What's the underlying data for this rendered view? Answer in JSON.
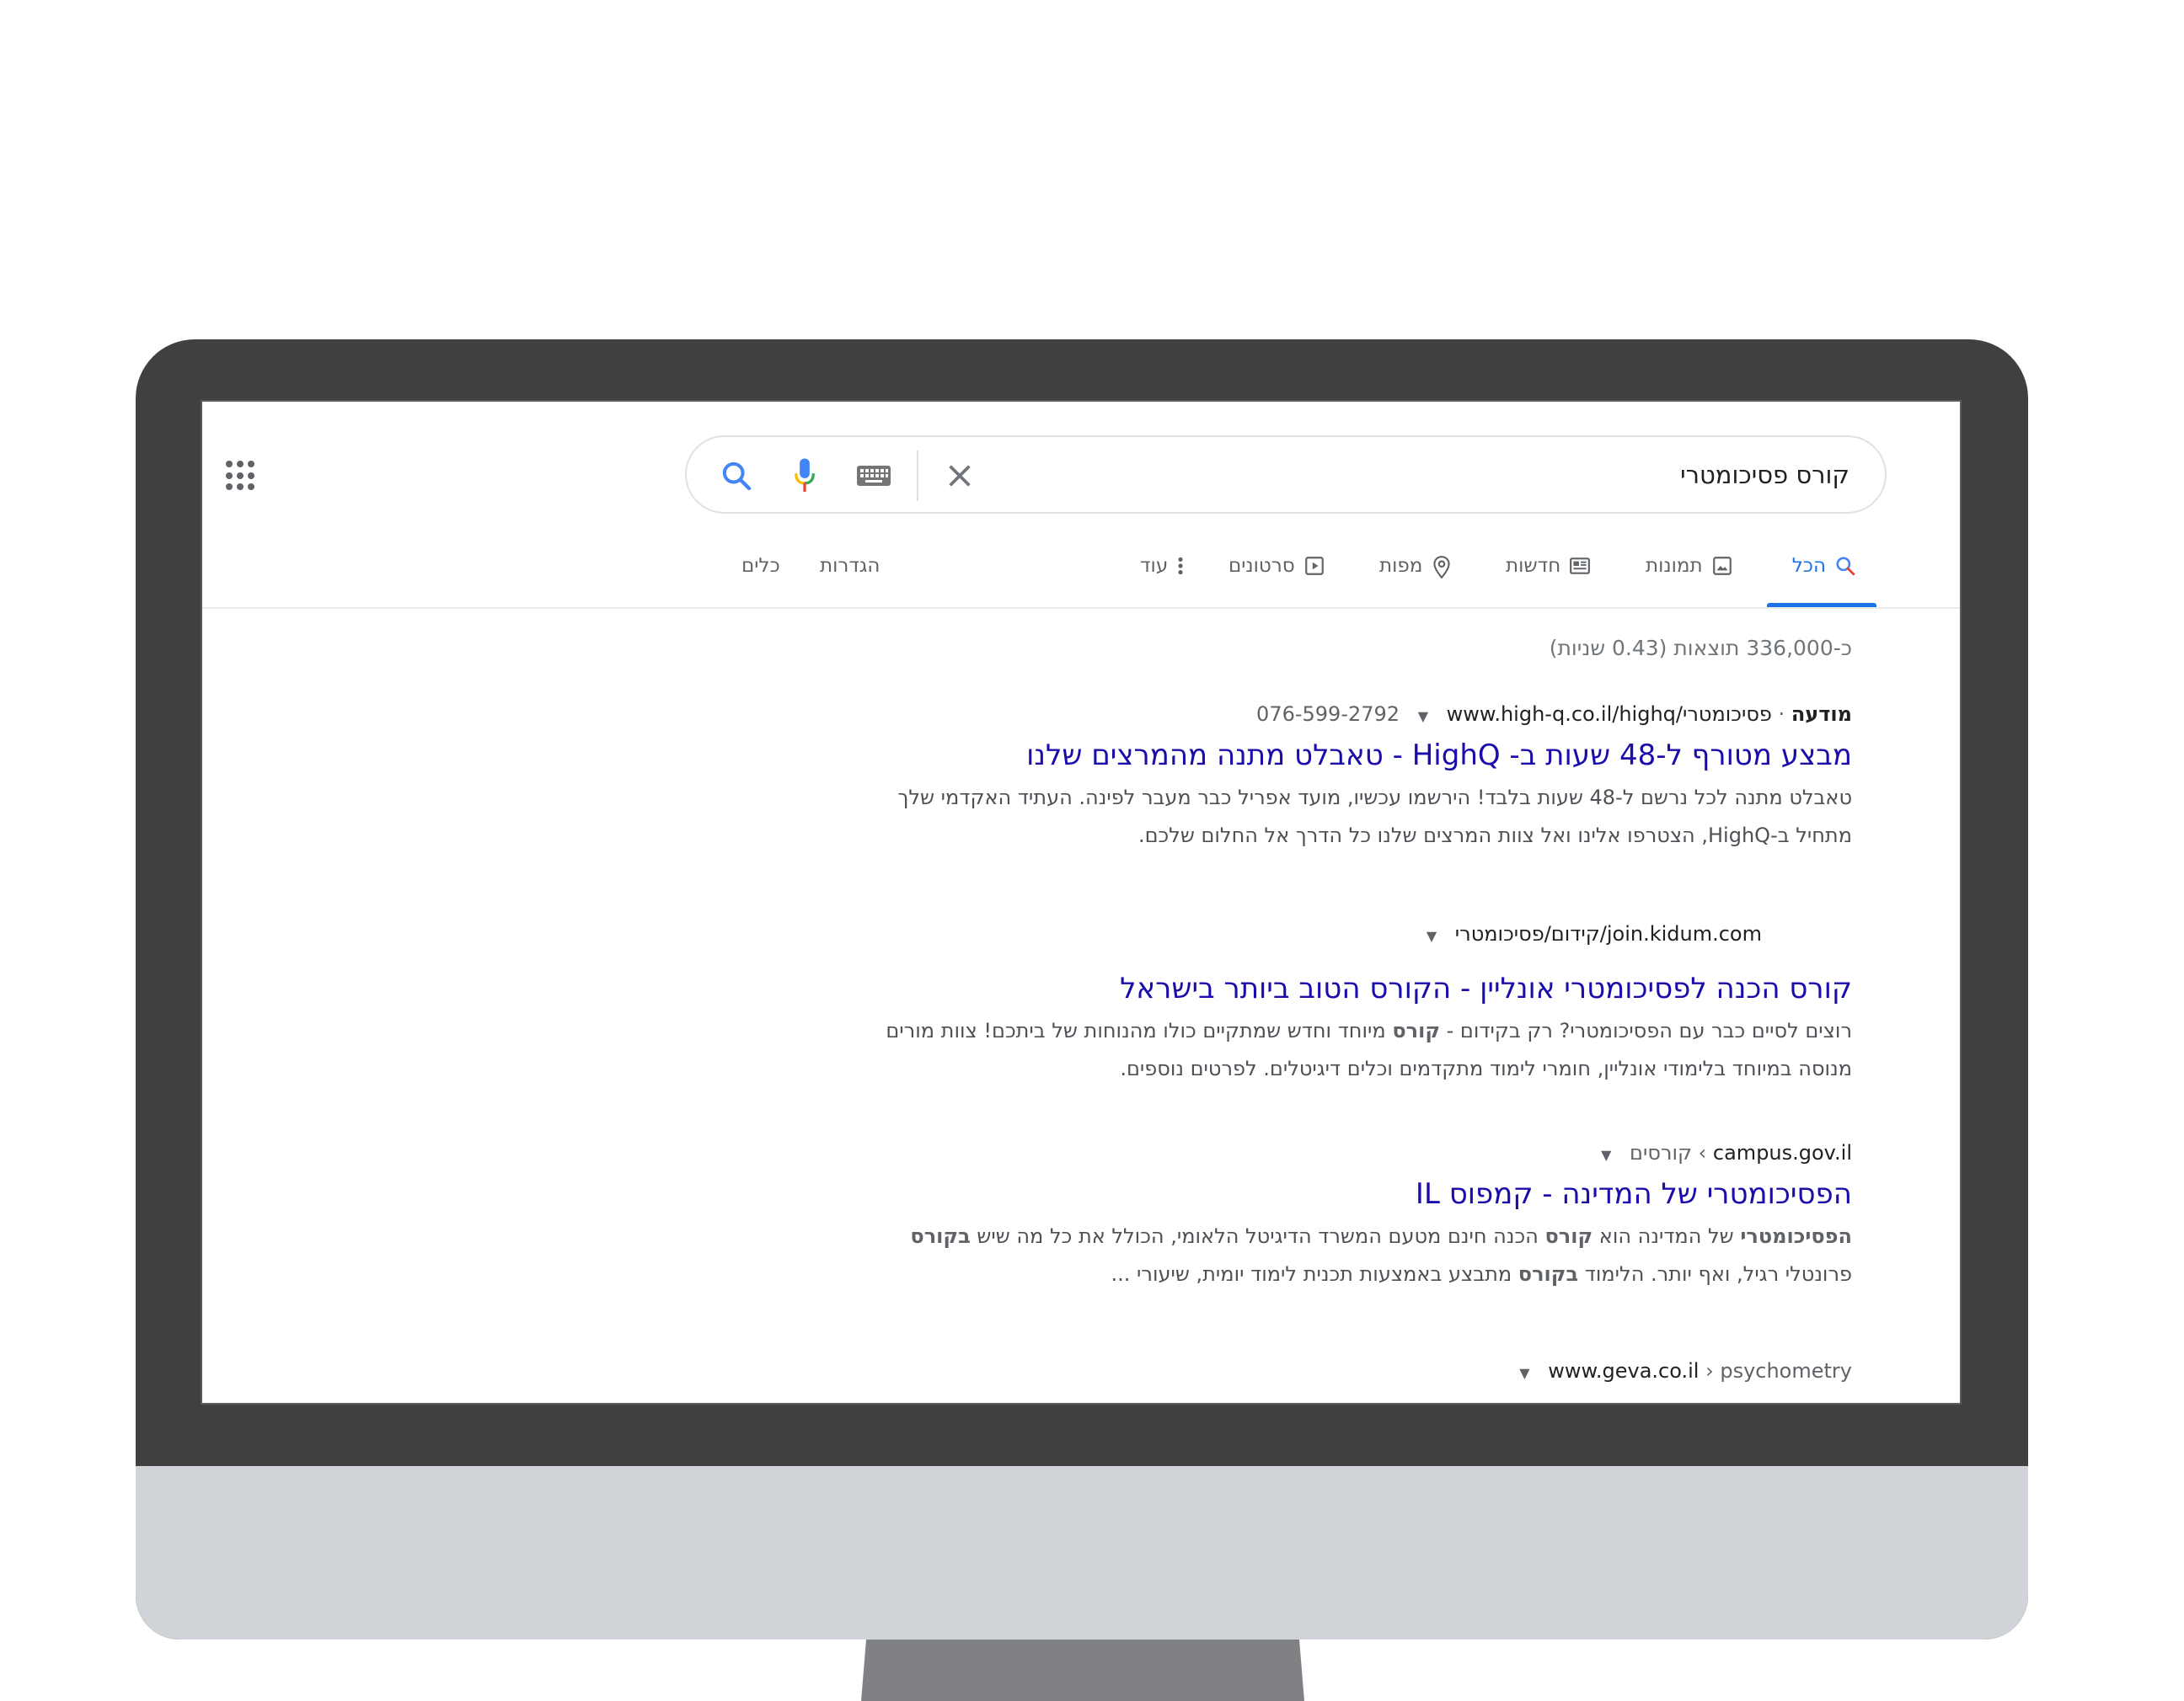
{
  "search": {
    "query": "קורס פסיכומטרי"
  },
  "tabs": [
    {
      "label": "הכל",
      "icon": "search-icon",
      "active": true
    },
    {
      "label": "תמונות",
      "icon": "image-icon"
    },
    {
      "label": "חדשות",
      "icon": "news-icon"
    },
    {
      "label": "מפות",
      "icon": "map-pin-icon"
    },
    {
      "label": "סרטונים",
      "icon": "video-icon"
    },
    {
      "label": "עוד",
      "icon": "more-vert-icon"
    }
  ],
  "tools": {
    "settings_label": "הגדרות",
    "tools_label": "כלים"
  },
  "result_stats": "כ-336,000 תוצאות (0.43 שניות)",
  "results": [
    {
      "ad_label": "מודעה",
      "url": "www.high-q.co.il/highq/פסיכומטרי",
      "phone": "076-599-2792",
      "title": "מבצע מטורף ל-48 שעות ב- HighQ - טאבלט מתנה מהמרצים שלנו",
      "snippet_line1": "טאבלט מתנה לכל נרשם ל-48 שעות בלבד! הירשמו עכשיו, מועד אפריל כבר מעבר לפינה. העתיד האקדמי שלך",
      "snippet_line2": "מתחיל ב-HighQ, הצטרפו אלינו ואל צוות המרצים שלנו כל הדרך אל החלום שלכם."
    },
    {
      "url": "join.kidum.com/קידום/פסיכומטרי",
      "title": "קורס הכנה לפסיכומטרי אונליין - הקורס הטוב ביותר בישראל",
      "snippet_part1": "רוצים לסיים כבר עם הפסיכומטרי? רק בקידום - ",
      "snippet_bold1": "קורס",
      "snippet_part2": " מיוחד וחדש שמתקיים כולו מהנוחות של ביתכם! צוות מורים",
      "snippet_line2": "מנוסה במיוחד בלימודי אונליין, חומרי לימוד מתקדמים וכלים דיגיטלים. לפרטים נוספים."
    },
    {
      "domain": "campus.gov.il",
      "breadcrumb": "› קורסים",
      "title": "הפסיכומטרי של המדינה - קמפוס IL",
      "snippet_bold1": "הפסיכומטרי",
      "snippet_part1": " של המדינה הוא ",
      "snippet_bold2": "קורס",
      "snippet_part2": " הכנה חינם מטעם המשרד הדיגיטל הלאומי, הכולל את כל מה שיש ",
      "snippet_bold3": "בקורס",
      "snippet_part3": "פרונטלי רגיל, ואף יותר. הלימוד ",
      "snippet_bold4": "בקורס",
      "snippet_part4": " מתבצע באמצעות תכנית לימוד יומית, שיעורי ..."
    },
    {
      "domain": "www.geva.co.il",
      "breadcrumb": "› psychometry"
    }
  ],
  "colors": {
    "link": "#1a0dab",
    "accent": "#1a73e8",
    "monitor_bezel": "#404041",
    "monitor_chin": "#d0d4d9"
  }
}
